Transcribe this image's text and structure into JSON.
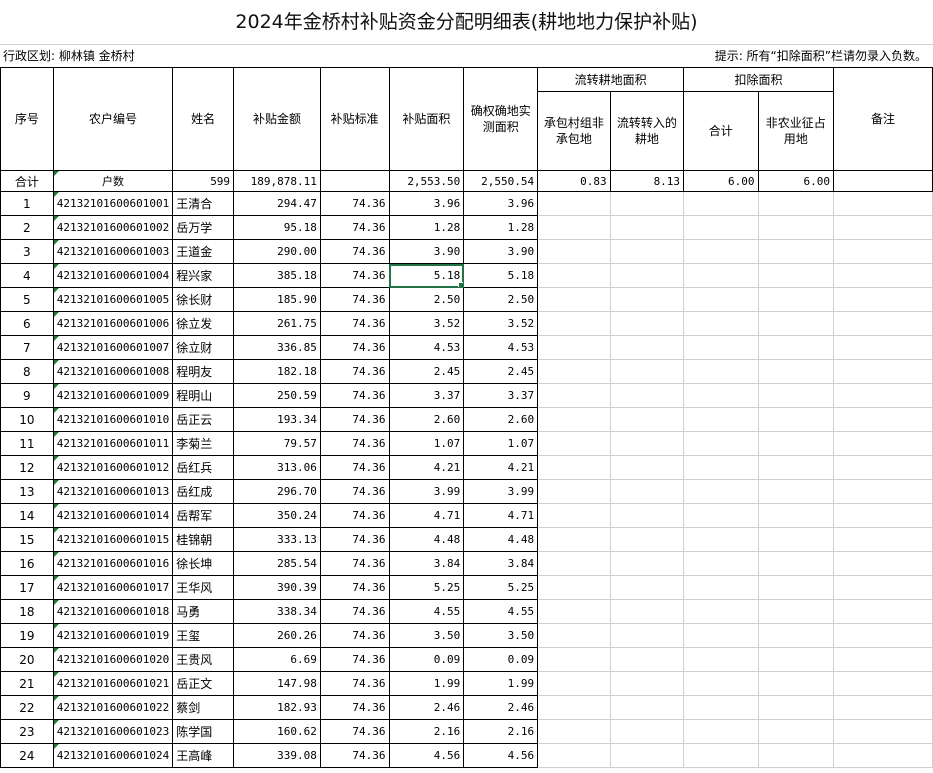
{
  "title": "2024年金桥村补贴资金分配明细表(耕地地力保护补贴)",
  "region": "行政区划: 柳林镇 金桥村",
  "hint": "提示: 所有“扣除面积”栏请勿录入负数。",
  "headers": {
    "seq": "序号",
    "code": "农户编号",
    "name": "姓名",
    "amount": "补贴金额",
    "standard": "补贴标准",
    "area": "补贴面积",
    "confirmed": "确权确地实测面积",
    "transfer_group": "流转耕地面积",
    "transfer_a": "承包村组非承包地",
    "transfer_b": "流转转入的耕地",
    "deduct_group": "扣除面积",
    "deduct_total": "合计",
    "deduct_nonfarm": "非农业征占用地",
    "note": "备注"
  },
  "summary": {
    "label": "合计",
    "households_label": "户数",
    "households": "599",
    "amount": "189,878.11",
    "area": "2,553.50",
    "confirmed": "2,550.54",
    "transfer_a": "0.83",
    "transfer_b": "8.13",
    "deduct_total": "6.00",
    "deduct_nonfarm": "6.00"
  },
  "rows": [
    {
      "seq": "1",
      "code": "4213210160060100​1",
      "name": "王清合",
      "amount": "294.47",
      "standard": "74.36",
      "area": "3.96",
      "confirmed": "3.96"
    },
    {
      "seq": "2",
      "code": "421321016006010​02",
      "name": "岳万学",
      "amount": "95.18",
      "standard": "74.36",
      "area": "1.28",
      "confirmed": "1.28"
    },
    {
      "seq": "3",
      "code": "42132101600601003",
      "name": "王道金",
      "amount": "290.00",
      "standard": "74.36",
      "area": "3.90",
      "confirmed": "3.90"
    },
    {
      "seq": "4",
      "code": "42132101600601004",
      "name": "程兴家",
      "amount": "385.18",
      "standard": "74.36",
      "area": "5.18",
      "confirmed": "5.18"
    },
    {
      "seq": "5",
      "code": "42132101600601005",
      "name": "徐长财",
      "amount": "185.90",
      "standard": "74.36",
      "area": "2.50",
      "confirmed": "2.50"
    },
    {
      "seq": "6",
      "code": "42132101600601006",
      "name": "徐立发",
      "amount": "261.75",
      "standard": "74.36",
      "area": "3.52",
      "confirmed": "3.52"
    },
    {
      "seq": "7",
      "code": "42132101600601007",
      "name": "徐立财",
      "amount": "336.85",
      "standard": "74.36",
      "area": "4.53",
      "confirmed": "4.53"
    },
    {
      "seq": "8",
      "code": "42132101600601008",
      "name": "程明友",
      "amount": "182.18",
      "standard": "74.36",
      "area": "2.45",
      "confirmed": "2.45"
    },
    {
      "seq": "9",
      "code": "42132101600601009",
      "name": "程明山",
      "amount": "250.59",
      "standard": "74.36",
      "area": "3.37",
      "confirmed": "3.37"
    },
    {
      "seq": "10",
      "code": "42132101600601010",
      "name": "岳正云",
      "amount": "193.34",
      "standard": "74.36",
      "area": "2.60",
      "confirmed": "2.60"
    },
    {
      "seq": "11",
      "code": "42132101600601011",
      "name": "李菊兰",
      "amount": "79.57",
      "standard": "74.36",
      "area": "1.07",
      "confirmed": "1.07"
    },
    {
      "seq": "12",
      "code": "42132101600601012",
      "name": "岳红兵",
      "amount": "313.06",
      "standard": "74.36",
      "area": "4.21",
      "confirmed": "4.21"
    },
    {
      "seq": "13",
      "code": "42132101600601013",
      "name": "岳红成",
      "amount": "296.70",
      "standard": "74.36",
      "area": "3.99",
      "confirmed": "3.99"
    },
    {
      "seq": "14",
      "code": "42132101600601014",
      "name": "岳帮军",
      "amount": "350.24",
      "standard": "74.36",
      "area": "4.71",
      "confirmed": "4.71"
    },
    {
      "seq": "15",
      "code": "42132101600601015",
      "name": "桂锦朝",
      "amount": "333.13",
      "standard": "74.36",
      "area": "4.48",
      "confirmed": "4.48"
    },
    {
      "seq": "16",
      "code": "42132101600601016",
      "name": "徐长坤",
      "amount": "285.54",
      "standard": "74.36",
      "area": "3.84",
      "confirmed": "3.84"
    },
    {
      "seq": "17",
      "code": "42132101600601017",
      "name": "王华风",
      "amount": "390.39",
      "standard": "74.36",
      "area": "5.25",
      "confirmed": "5.25"
    },
    {
      "seq": "18",
      "code": "42132101600601018",
      "name": "马勇",
      "amount": "338.34",
      "standard": "74.36",
      "area": "4.55",
      "confirmed": "4.55"
    },
    {
      "seq": "19",
      "code": "42132101600601019",
      "name": "王玺",
      "amount": "260.26",
      "standard": "74.36",
      "area": "3.50",
      "confirmed": "3.50"
    },
    {
      "seq": "20",
      "code": "42132101600601020",
      "name": "王贵风",
      "amount": "6.69",
      "standard": "74.36",
      "area": "0.09",
      "confirmed": "0.09"
    },
    {
      "seq": "21",
      "code": "42132101600601021",
      "name": "岳正文",
      "amount": "147.98",
      "standard": "74.36",
      "area": "1.99",
      "confirmed": "1.99"
    },
    {
      "seq": "22",
      "code": "42132101600601022",
      "name": "蔡剑",
      "amount": "182.93",
      "standard": "74.36",
      "area": "2.46",
      "confirmed": "2.46"
    },
    {
      "seq": "23",
      "code": "42132101600601023",
      "name": "陈学国",
      "amount": "160.62",
      "standard": "74.36",
      "area": "2.16",
      "confirmed": "2.16"
    },
    {
      "seq": "24",
      "code": "42132101600601024",
      "name": "王高峰",
      "amount": "339.08",
      "standard": "74.36",
      "area": "4.56",
      "confirmed": "4.56"
    }
  ],
  "selected_cell": {
    "row": "4",
    "column": "area"
  },
  "colors": {
    "selection": "#217346",
    "flag": "#1f7a2c"
  }
}
